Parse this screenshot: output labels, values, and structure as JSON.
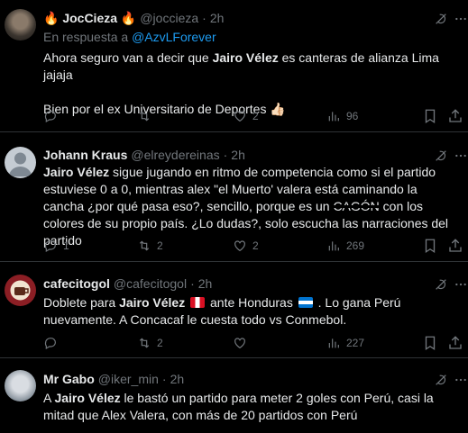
{
  "tweets": [
    {
      "name": "🔥 JocCieza 🔥",
      "handle": "@joccieza",
      "time": "2h",
      "reply_prefix": "En respuesta a",
      "reply_to": "@AzvLForever",
      "text_parts": [
        {
          "t": "Ahora seguro van a decir que ",
          "b": false
        },
        {
          "t": "Jairo Vélez",
          "b": true
        },
        {
          "t": " es canteras de alianza Lima jajaja",
          "b": false
        }
      ],
      "text2": "Bien por el ex Universitario de Deportes 👍🏻",
      "replies": "",
      "retweets": "",
      "likes": "2",
      "views": "96"
    },
    {
      "name": "Johann Kraus",
      "handle": "@elreydereinas",
      "time": "2h",
      "text_parts": [
        {
          "t": "Jairo Vélez",
          "b": true
        },
        {
          "t": " sigue jugando en ritmo de competencia como si el partido estuviese 0 a 0, mientras alex \"el Muerto' valera está caminando la cancha ¿por qué pasa eso?, sencillo, porque es un ",
          "b": false
        },
        {
          "t": "CAGÓN",
          "b": false,
          "censor": true
        },
        {
          "t": " con los colores de su propio país. ¿Lo dudas?, solo escucha las narraciones del partido",
          "b": false
        }
      ],
      "replies": "1",
      "retweets": "2",
      "likes": "2",
      "views": "269"
    },
    {
      "name": "cafecitogol",
      "handle": "@cafecitogol",
      "time": "2h",
      "text_parts": [
        {
          "t": "Doblete para ",
          "b": false
        },
        {
          "t": "Jairo Vélez",
          "b": true
        },
        {
          "t": " ",
          "b": false,
          "flag": "pe"
        },
        {
          "t": " ante Honduras ",
          "b": false
        },
        {
          "t": "",
          "b": false,
          "flag": "hn"
        },
        {
          "t": " . Lo gana Perú nuevamente. A Concacaf le cuesta todo vs Conmebol.",
          "b": false
        }
      ],
      "replies": "",
      "retweets": "2",
      "likes": "",
      "views": "227"
    },
    {
      "name": "Mr Gabo",
      "handle": "@iker_min",
      "time": "2h",
      "text_parts": [
        {
          "t": "A ",
          "b": false
        },
        {
          "t": "Jairo Vélez",
          "b": true
        },
        {
          "t": " le bastó un partido para meter 2 goles con Perú, casi la mitad que Alex Valera, con más de 20 partidos con Perú",
          "b": false
        }
      ]
    }
  ],
  "icons": [
    "reply-icon",
    "retweet-icon",
    "like-icon",
    "views-icon",
    "bookmark-icon",
    "share-icon",
    "grok-icon",
    "more-icon"
  ],
  "colors": {
    "background": "#000000",
    "text": "#e7e9ea",
    "muted": "#71767b",
    "link": "#1d9bf0",
    "divider": "#2f3336"
  }
}
